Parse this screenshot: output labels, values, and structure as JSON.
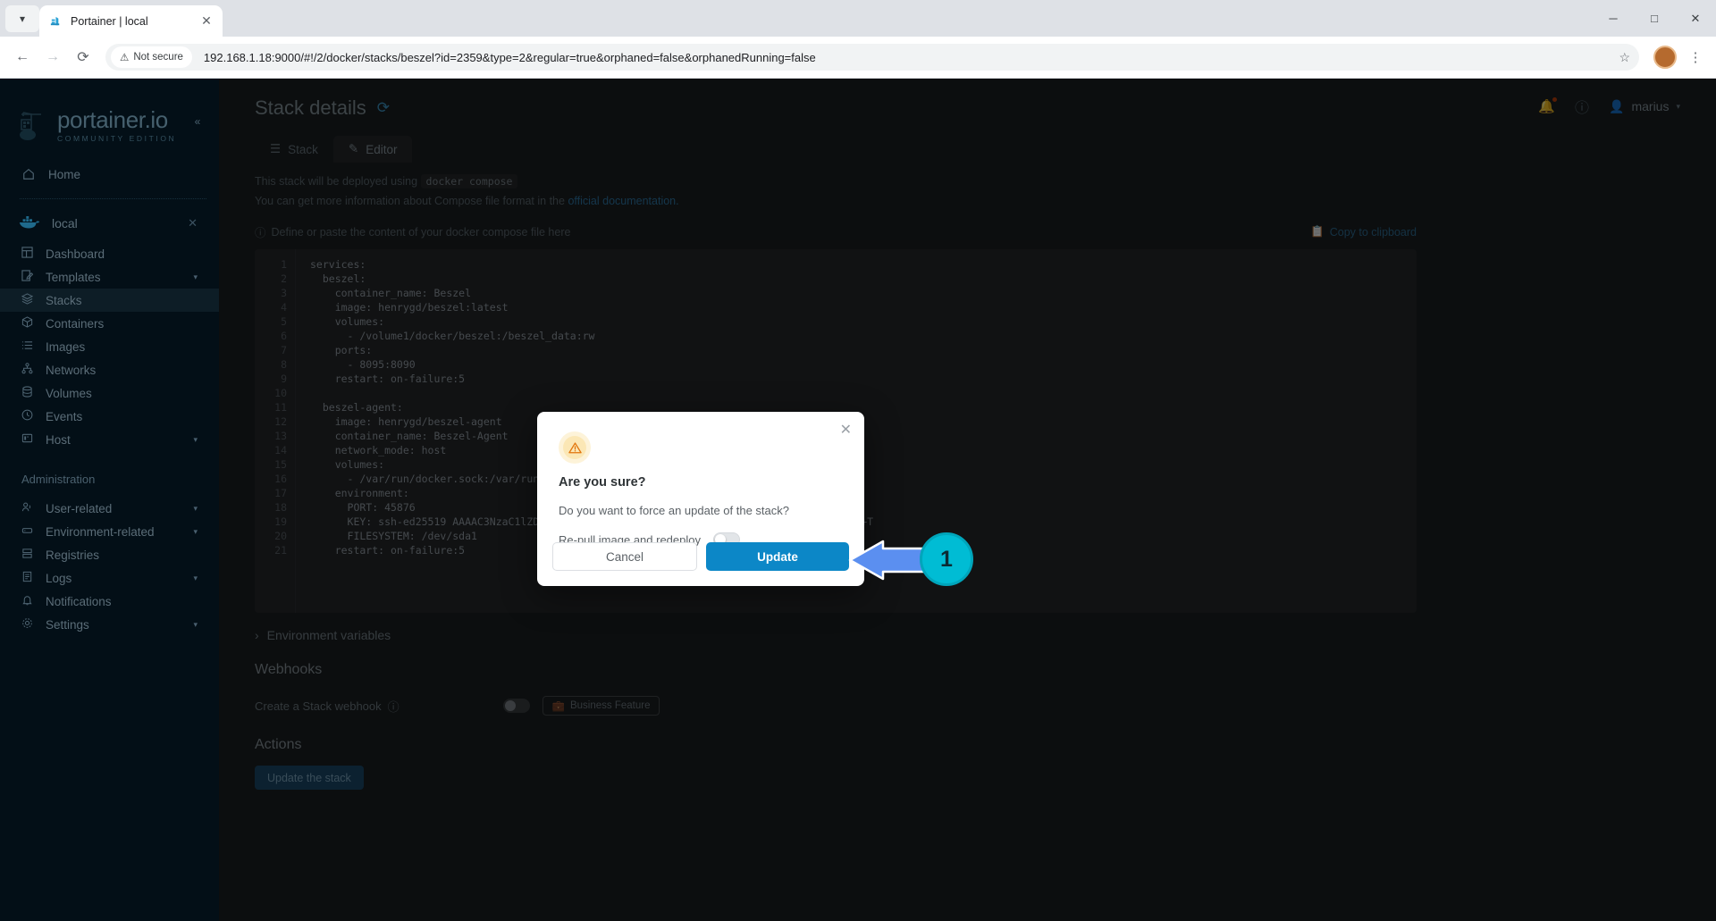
{
  "browser": {
    "tab": {
      "title": "Portainer | local",
      "favicon_icon": "portainer-favicon",
      "close_icon": "close-icon"
    },
    "tab_list_chevron_icon": "chevron-down-icon",
    "window": {
      "minimize_icon": "minimize-icon",
      "maximize_icon": "maximize-icon",
      "close_icon": "window-close-icon"
    },
    "nav": {
      "back_icon": "arrow-left-icon",
      "forward_icon": "arrow-right-icon",
      "reload_icon": "reload-icon"
    },
    "omnibox": {
      "security_label": "Not secure",
      "security_icon": "warning-triangle-icon",
      "url": "192.168.1.18:9000/#!/2/docker/stacks/beszel?id=2359&type=2&regular=true&orphaned=false&orphanedRunning=false",
      "bookmark_icon": "star-icon"
    },
    "profile_initial": "",
    "menu_icon": "kebab-menu-icon"
  },
  "sidebar": {
    "brand": {
      "name": "portainer.io",
      "subtitle": "COMMUNITY EDITION",
      "logo_icon": "portainer-logo-icon"
    },
    "collapse_icon": "chevron-double-left-icon",
    "home": {
      "label": "Home",
      "icon": "home-icon"
    },
    "environment": {
      "label": "local",
      "icon": "docker-whale-icon",
      "close_icon": "close-icon"
    },
    "items": [
      {
        "label": "Dashboard",
        "icon": "dashboard-icon",
        "active": false,
        "chevron": false
      },
      {
        "label": "Templates",
        "icon": "template-icon",
        "active": false,
        "chevron": true
      },
      {
        "label": "Stacks",
        "icon": "stacks-icon",
        "active": true,
        "chevron": false
      },
      {
        "label": "Containers",
        "icon": "container-icon",
        "active": false,
        "chevron": false
      },
      {
        "label": "Images",
        "icon": "images-icon",
        "active": false,
        "chevron": false
      },
      {
        "label": "Networks",
        "icon": "networks-icon",
        "active": false,
        "chevron": false
      },
      {
        "label": "Volumes",
        "icon": "volumes-icon",
        "active": false,
        "chevron": false
      },
      {
        "label": "Events",
        "icon": "events-clock-icon",
        "active": false,
        "chevron": false
      },
      {
        "label": "Host",
        "icon": "host-icon",
        "active": false,
        "chevron": true
      }
    ],
    "admin_title": "Administration",
    "admin_items": [
      {
        "label": "User-related",
        "icon": "users-icon",
        "chevron": true
      },
      {
        "label": "Environment-related",
        "icon": "environment-icon",
        "chevron": true
      },
      {
        "label": "Registries",
        "icon": "registries-icon",
        "chevron": false
      },
      {
        "label": "Logs",
        "icon": "logs-icon",
        "chevron": true
      },
      {
        "label": "Notifications",
        "icon": "notifications-icon",
        "chevron": false
      },
      {
        "label": "Settings",
        "icon": "settings-gear-icon",
        "chevron": true
      }
    ]
  },
  "header": {
    "title": "Stack details",
    "refresh_icon": "refresh-icon",
    "bell_icon": "bell-icon",
    "help_icon": "help-circle-icon",
    "user_icon": "user-icon",
    "username": "marius",
    "caret_icon": "chevron-down-icon"
  },
  "main": {
    "tabs": [
      {
        "label": "Stack",
        "icon": "list-icon",
        "active": false
      },
      {
        "label": "Editor",
        "icon": "pencil-icon",
        "active": true
      }
    ],
    "hint1_prefix": "This stack will be deployed using",
    "hint1_code": "docker compose",
    "hint2_prefix": "You can get more information about Compose file format in the",
    "hint2_link": "official documentation.",
    "editor_label": "Define or paste the content of your docker compose file here",
    "editor_label_icon": "info-circle-icon",
    "copy_label": "Copy to clipboard",
    "copy_icon": "copy-icon",
    "code_lines": [
      "services:",
      "  beszel:",
      "    container_name: Beszel",
      "    image: henrygd/beszel:latest",
      "    volumes:",
      "      - /volume1/docker/beszel:/beszel_data:rw",
      "    ports:",
      "      - 8095:8090",
      "    restart: on-failure:5",
      "",
      "  beszel-agent:",
      "    image: henrygd/beszel-agent",
      "    container_name: Beszel-Agent",
      "    network_mode: host",
      "    volumes:",
      "      - /var/run/docker.sock:/var/run/docker.sock",
      "    environment:",
      "      PORT: 45876",
      "      KEY: ssh-ed25519 AAAAC3NzaC1lZDI1NTE5AAAAICc96IBJsxaEP6t6mQCgUiCNonUd3h1XLQMcI4c0Ns+T",
      "      FILESYSTEM: /dev/sda1",
      "    restart: on-failure:5"
    ],
    "env_vars_collapse": "Environment variables",
    "env_vars_chevron_icon": "chevron-right-icon",
    "webhooks_title": "Webhooks",
    "webhook_label": "Create a Stack webhook",
    "webhook_help_icon": "help-circle-icon",
    "webhook_toggle_state": "off",
    "business_feature_label": "Business Feature",
    "business_feature_icon": "briefcase-icon",
    "actions_title": "Actions",
    "update_stack_label": "Update the stack"
  },
  "modal": {
    "warning_icon": "warning-triangle-icon",
    "close_icon": "close-icon",
    "title": "Are you sure?",
    "message": "Do you want to force an update of the stack?",
    "toggle_label": "Re-pull image and redeploy",
    "toggle_state": "off",
    "cancel_label": "Cancel",
    "update_label": "Update"
  },
  "annotation": {
    "step_number": "1",
    "arrow_icon": "arrow-left-icon"
  },
  "colors": {
    "accent_blue": "#0c87c7",
    "sidebar_bg": "#030f17",
    "content_bg": "#1b1f22",
    "editor_bg": "#26292c",
    "warning_orange": "#e2750c",
    "annotation_cyan": "#00bcd4"
  }
}
